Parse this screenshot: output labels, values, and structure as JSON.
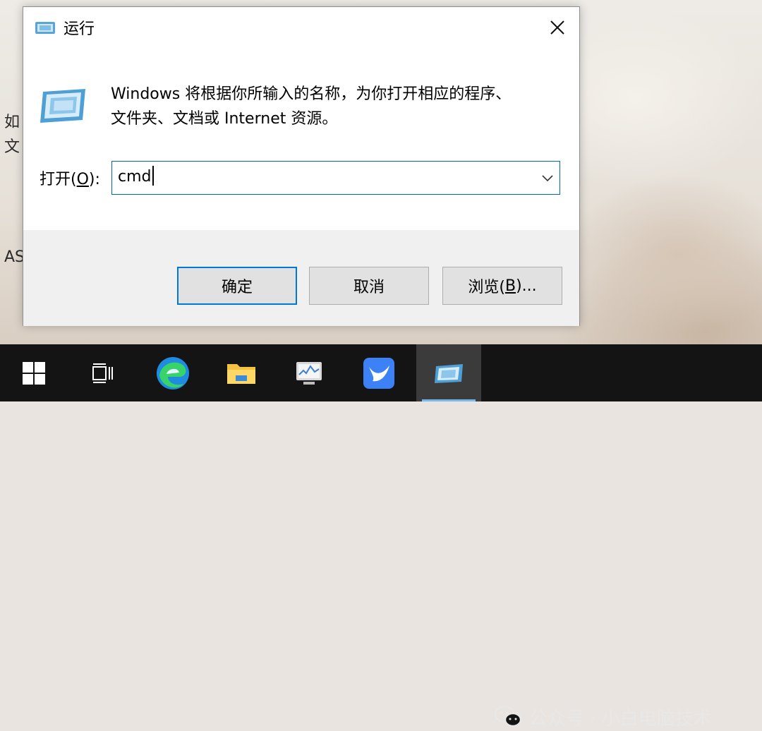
{
  "desktop": {
    "partial_labels": [
      "如",
      "文",
      "AS"
    ]
  },
  "dialog": {
    "title": "运行",
    "description_line1": "Windows 将根据你所输入的名称，为你打开相应的程序、",
    "description_line2": "文件夹、文档或 Internet 资源。",
    "open_label_prefix": "打开(",
    "open_label_key": "O",
    "open_label_suffix": "):",
    "input_value": "cmd",
    "buttons": {
      "ok": "确定",
      "cancel": "取消",
      "browse_prefix": "浏览(",
      "browse_key": "B",
      "browse_suffix": ")..."
    },
    "icons": {
      "title": "run-icon",
      "close": "close-icon",
      "dropdown": "chevron-down-icon"
    }
  },
  "taskbar": {
    "items": [
      "start-icon",
      "task-view-icon",
      "edge-icon",
      "file-explorer-icon",
      "performance-monitor-icon",
      "feishu-icon",
      "run-icon"
    ],
    "watermark": "公众号 · 小白电脑技术",
    "accent_color": "#76b9ed"
  },
  "colors": {
    "focus_border": "#0067c0",
    "default_button_border": "#0078d7",
    "taskbar_bg": "#141414"
  }
}
